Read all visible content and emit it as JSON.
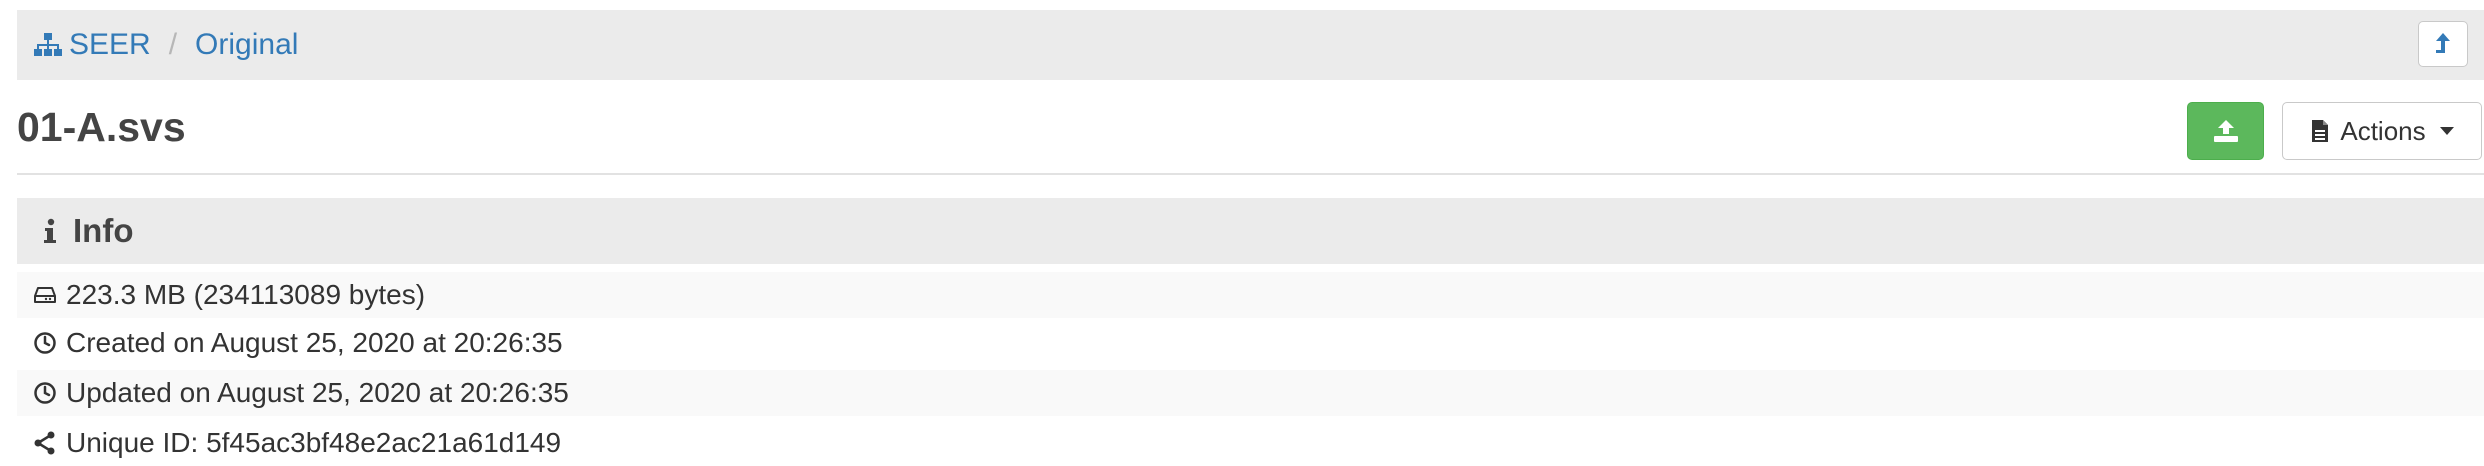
{
  "breadcrumb": {
    "root_icon": "sitemap-icon",
    "items": [
      "SEER",
      "Original"
    ],
    "separator": "/"
  },
  "toolbar": {
    "up_icon": "level-up-icon",
    "upload_icon": "upload-icon",
    "actions_icon": "file-icon",
    "actions_label": "Actions"
  },
  "item": {
    "title": "01-A.svs"
  },
  "info": {
    "heading": "Info",
    "heading_icon": "info-icon",
    "size": "223.3 MB (234113089 bytes)",
    "created": "Created on August 25, 2020 at 20:26:35",
    "updated": "Updated on August 25, 2020 at 20:26:35",
    "unique_id": "Unique ID: 5f45ac3bf48e2ac21a61d149"
  },
  "colors": {
    "link": "#337ab7",
    "success": "#5cb85c",
    "panel_bg": "#ebebeb"
  }
}
